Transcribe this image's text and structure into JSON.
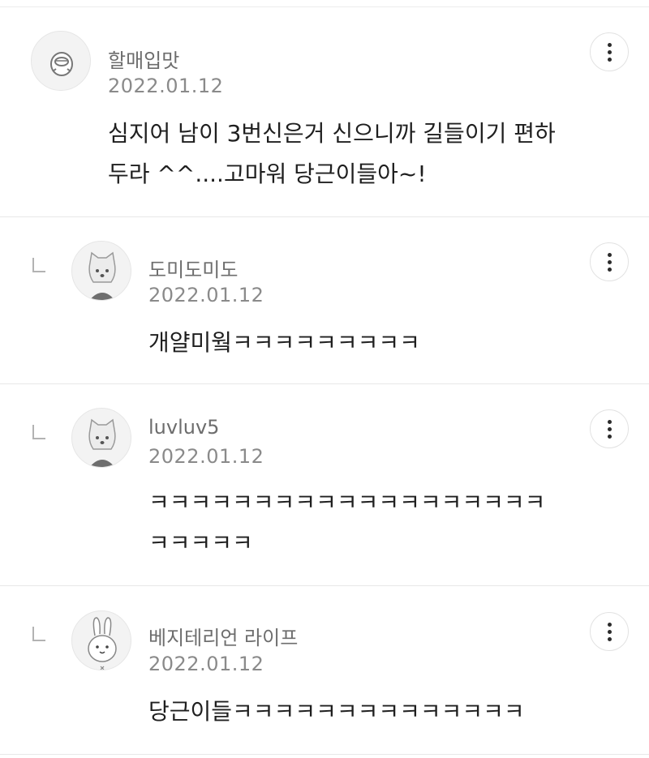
{
  "comments": [
    {
      "author": "할매입맛",
      "date": "2022.01.12",
      "text": "심지어 남이 3번신은거 신으니까 길들이기 편하\n두라 ^^....고마워 당근이들아~!",
      "avatar_icon": "duck-character-icon",
      "is_reply": false
    },
    {
      "author": "도미도미도",
      "date": "2022.01.12",
      "text": "개얄미웤ㅋㅋㅋㅋㅋㅋㅋㅋㅋ",
      "avatar_icon": "cat-character-icon",
      "is_reply": true
    },
    {
      "author": "luvluv5",
      "date": "2022.01.12",
      "text": "ㅋㅋㅋㅋㅋㅋㅋㅋㅋㅋㅋㅋㅋㅋㅋㅋㅋㅋㅋ\nㅋㅋㅋㅋㅋ",
      "avatar_icon": "cat-character-icon",
      "is_reply": true
    },
    {
      "author": "베지테리언 라이프",
      "date": "2022.01.12",
      "text": "당근이들ㅋㅋㅋㅋㅋㅋㅋㅋㅋㅋㅋㅋㅋㅋ",
      "avatar_icon": "rabbit-character-icon",
      "is_reply": true
    }
  ],
  "more_icon": "more-vertical-icon",
  "reply_icon": "reply-arrow-icon"
}
